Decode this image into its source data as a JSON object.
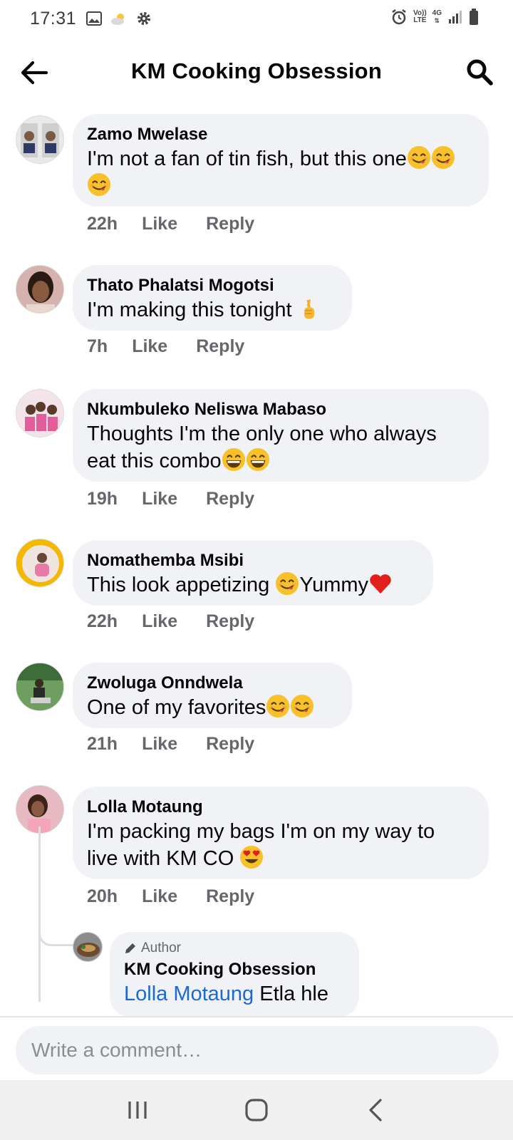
{
  "status_bar": {
    "time": "17:31",
    "volte_top": "Vo))",
    "volte_bottom": "LTE",
    "network": "4G"
  },
  "header": {
    "title": "KM Cooking Obsession",
    "back_icon": "arrow-left-icon",
    "search_icon": "search-icon"
  },
  "comments": [
    {
      "author": "Zamo Mwelase",
      "text": "I'm not a fan of tin fish, but this one",
      "emoji": "yum-face x3",
      "time": "22h",
      "like": "Like",
      "reply": "Reply"
    },
    {
      "author": "Thato Phalatsi Mogotsi",
      "text": "I'm making this tonight ",
      "emoji": "crossed-fingers",
      "time": "7h",
      "like": "Like",
      "reply": "Reply"
    },
    {
      "author": "Nkumbuleko Neliswa Mabaso",
      "text_line1": "Thoughts I'm the only one who always",
      "text_line2": "eat this combo",
      "emoji": "grinning x2",
      "time": "19h",
      "like": "Like",
      "reply": "Reply"
    },
    {
      "author": "Nomathemba Msibi",
      "text_a": "This look appetizing ",
      "text_b": "Yummy",
      "emoji": "yum-face, red-heart",
      "time": "22h",
      "like": "Like",
      "reply": "Reply"
    },
    {
      "author": "Zwoluga Onndwela",
      "text": "One of my favorites",
      "emoji": "yum-face x2",
      "time": "21h",
      "like": "Like",
      "reply": "Reply"
    },
    {
      "author": "Lolla Motaung",
      "text_line1": "I'm packing my bags I'm on my way to",
      "text_line2": "live with KM CO ",
      "emoji": "heart-eyes",
      "time": "20h",
      "like": "Like",
      "reply": "Reply"
    }
  ],
  "author_reply": {
    "badge": "Author",
    "author": "KM Cooking Obsession",
    "mention": "Lolla Motaung",
    "text": " Etla hle"
  },
  "composer": {
    "placeholder": "Write a comment…"
  },
  "colors": {
    "bubble": "#f0f2f5",
    "meta": "#65676b",
    "mention": "#1b6ad4",
    "heart": "#e0201a",
    "emoji": "#f7c12b"
  }
}
